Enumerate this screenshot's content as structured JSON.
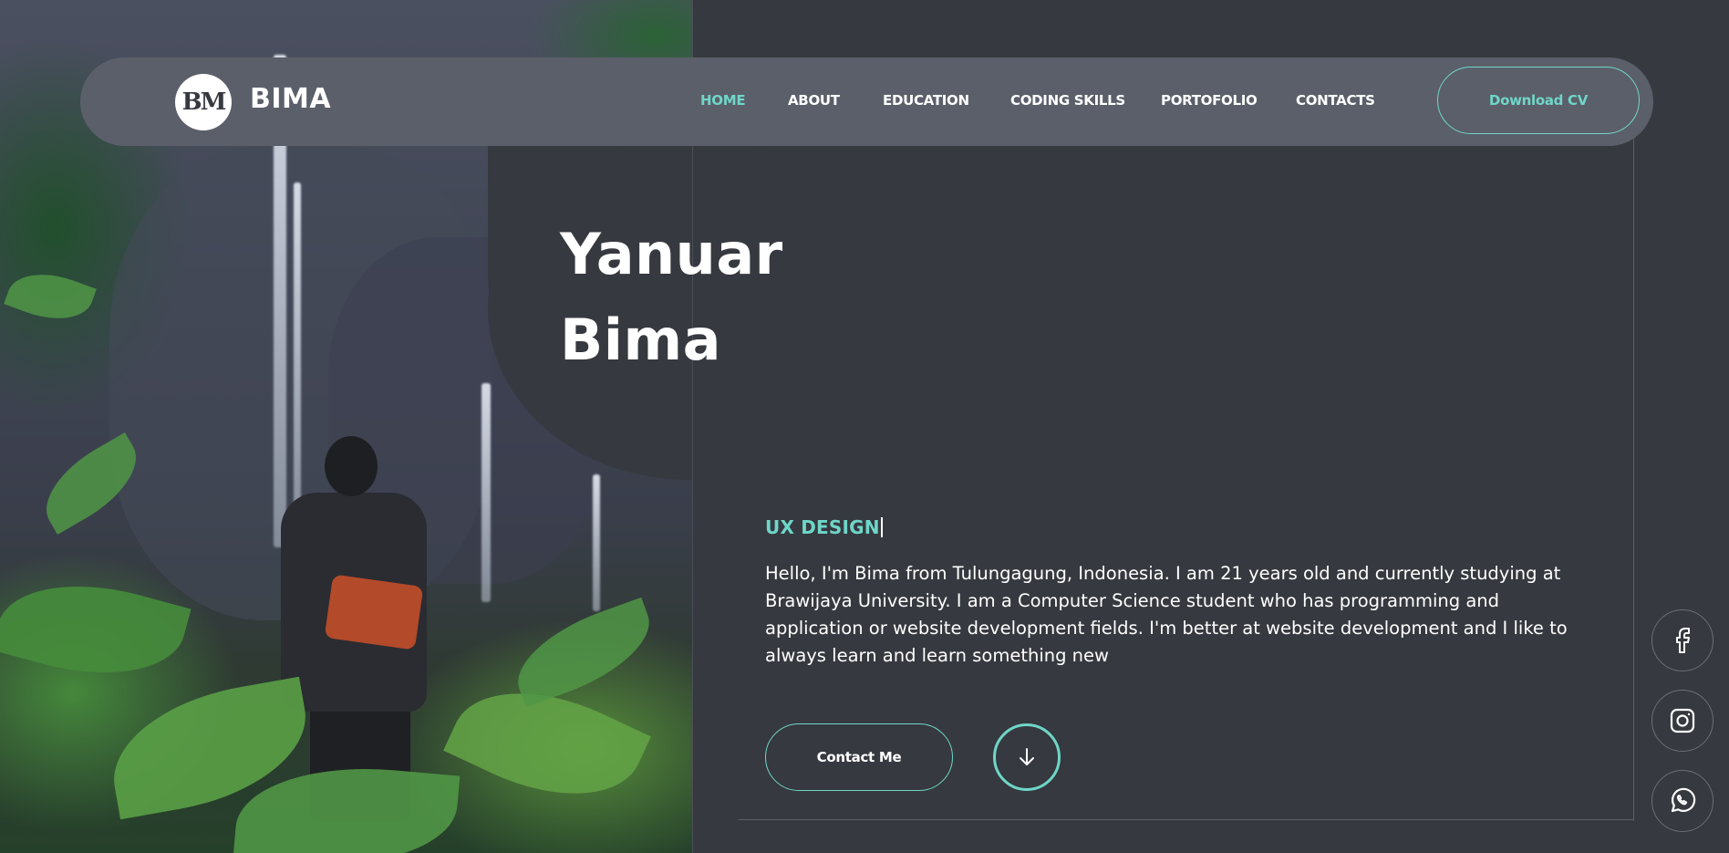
{
  "brand": {
    "logo_text": "BM",
    "name": "BIMA"
  },
  "nav": {
    "items": [
      {
        "label": "HOME",
        "active": true
      },
      {
        "label": "ABOUT",
        "active": false
      },
      {
        "label": "EDUCATION",
        "active": false
      },
      {
        "label": "CODING SKILLS",
        "active": false
      },
      {
        "label": "PORTOFOLIO",
        "active": false
      },
      {
        "label": "CONTACTS",
        "active": false
      }
    ],
    "cv_button": "Download CV"
  },
  "hero": {
    "first_name": "Yanuar",
    "last_name": "Bima",
    "role": "UX DESIGN",
    "intro": "Hello, I'm Bima from Tulungagung, Indonesia. I am 21 years old and currently studying at Brawijaya University. I am a Computer Science student who has programming and application or website development fields. I'm better at website development and I like to always learn and learn something new",
    "contact_button": "Contact Me",
    "scroll_icon": "arrow-down-icon"
  },
  "social": [
    {
      "icon": "facebook-icon"
    },
    {
      "icon": "instagram-icon"
    },
    {
      "icon": "whatsapp-icon"
    }
  ],
  "colors": {
    "background": "#36393f",
    "navbar": "#5b5f6a",
    "accent": "#6fd6c8",
    "text": "#ffffff"
  }
}
